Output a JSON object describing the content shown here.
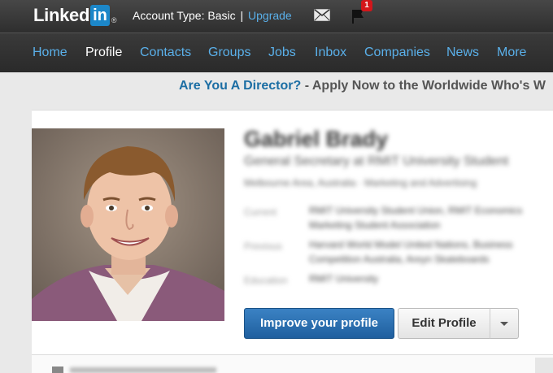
{
  "topbar": {
    "logo_text": "Linked",
    "logo_in": "in",
    "logo_reg": "®",
    "account_label": "Account Type: Basic",
    "separator": "|",
    "upgrade_label": "Upgrade",
    "notification_count": "1"
  },
  "nav": {
    "items": [
      {
        "label": "Home"
      },
      {
        "label": "Profile"
      },
      {
        "label": "Contacts"
      },
      {
        "label": "Groups"
      },
      {
        "label": "Jobs"
      },
      {
        "label": "Inbox"
      },
      {
        "label": "Companies"
      },
      {
        "label": "News"
      },
      {
        "label": "More"
      }
    ],
    "active_index": 1
  },
  "banner": {
    "question": "Are You A Director?",
    "rest": " - Apply Now to the Worldwide Who's W"
  },
  "profile": {
    "name": "Gabriel Brady",
    "headline": "General Secretary at RMIT University Student",
    "location": "Melbourne Area, Australia · Marketing and Advertising",
    "rows": [
      {
        "label": "Current",
        "lines": [
          "RMIT University Student Union, RMIT Economics",
          "Marketing Student Association"
        ]
      },
      {
        "label": "Previous",
        "lines": [
          "Harvard World Model United Nations, Business",
          "Competition Australia, Areyn Skateboards"
        ]
      },
      {
        "label": "Education",
        "lines": [
          "RMIT University"
        ]
      }
    ]
  },
  "actions": {
    "improve_label": "Improve your profile",
    "edit_label": "Edit Profile"
  },
  "colors": {
    "accent": "#1c87c9",
    "link": "#5ab0ea",
    "primary_button": "#2a6fb3"
  }
}
